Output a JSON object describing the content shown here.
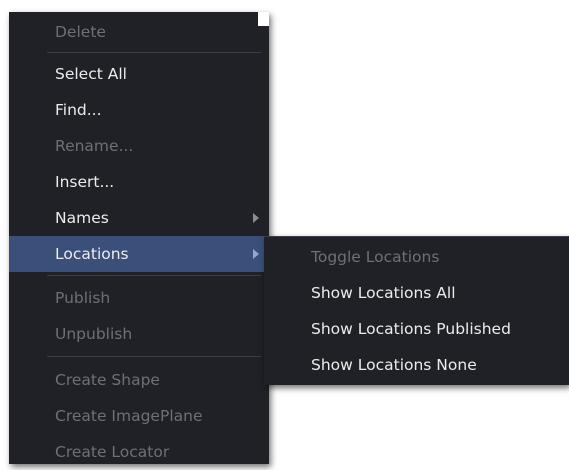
{
  "main_menu": {
    "items": [
      {
        "label": "Delete",
        "enabled": false
      },
      {
        "label": "Select All",
        "enabled": true
      },
      {
        "label": "Find...",
        "enabled": true
      },
      {
        "label": "Rename...",
        "enabled": false
      },
      {
        "label": "Insert...",
        "enabled": true
      },
      {
        "label": "Names",
        "enabled": true,
        "has_submenu": true
      },
      {
        "label": "Locations",
        "enabled": true,
        "has_submenu": true,
        "selected": true
      },
      {
        "label": "Publish",
        "enabled": false
      },
      {
        "label": "Unpublish",
        "enabled": false
      },
      {
        "label": "Create Shape",
        "enabled": false
      },
      {
        "label": "Create ImagePlane",
        "enabled": false
      },
      {
        "label": "Create Locator",
        "enabled": false
      }
    ]
  },
  "locations_submenu": {
    "items": [
      {
        "label": "Toggle Locations",
        "enabled": false
      },
      {
        "label": "Show Locations All",
        "enabled": true
      },
      {
        "label": "Show Locations Published",
        "enabled": true
      },
      {
        "label": "Show Locations None",
        "enabled": true
      }
    ]
  },
  "colors": {
    "menu_background": "#1f2126",
    "highlight": "#3a4f79",
    "text_enabled": "#ececec",
    "text_disabled": "#6d7079"
  }
}
